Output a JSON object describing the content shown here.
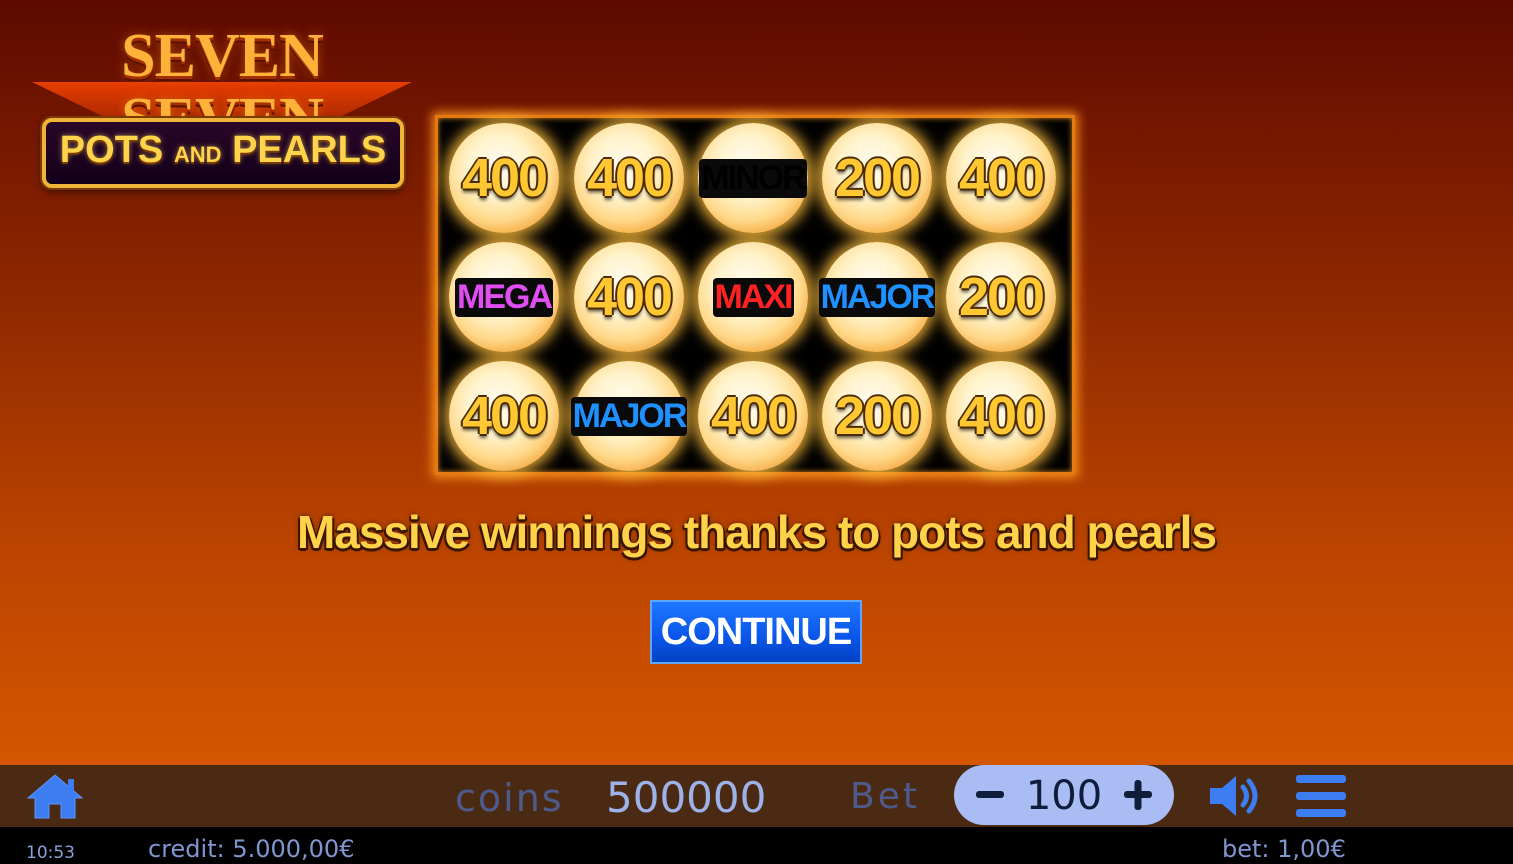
{
  "logo": {
    "title": "SEVEN SEVEN",
    "subtitle_pots": "POTS",
    "subtitle_and": "AND",
    "subtitle_pearls": "PEARLS"
  },
  "grid": {
    "rows": [
      [
        {
          "text": "400",
          "kind": "number"
        },
        {
          "text": "400",
          "kind": "number"
        },
        {
          "text": "MINOR",
          "kind": "minor"
        },
        {
          "text": "200",
          "kind": "number"
        },
        {
          "text": "400",
          "kind": "number"
        }
      ],
      [
        {
          "text": "MEGA",
          "kind": "mega"
        },
        {
          "text": "400",
          "kind": "number"
        },
        {
          "text": "MAXI",
          "kind": "maxi"
        },
        {
          "text": "MAJOR",
          "kind": "major"
        },
        {
          "text": "200",
          "kind": "number"
        }
      ],
      [
        {
          "text": "400",
          "kind": "number"
        },
        {
          "text": "MAJOR",
          "kind": "major"
        },
        {
          "text": "400",
          "kind": "number"
        },
        {
          "text": "200",
          "kind": "number"
        },
        {
          "text": "400",
          "kind": "number"
        }
      ]
    ],
    "pearl_flags": [
      [
        true,
        true,
        true,
        false,
        true
      ],
      [
        false,
        true,
        false,
        false,
        true
      ],
      [
        true,
        true,
        true,
        true,
        true
      ]
    ]
  },
  "message": "Massive winnings thanks to pots and pearls",
  "continue_label": "CONTINUE",
  "controls": {
    "coins_label": "coins",
    "coins_value": "500000",
    "bet_label": "Bet",
    "bet_value": "100"
  },
  "status": {
    "clock": "10:53",
    "credit": "credit: 5.000,00€",
    "bet": "bet: 1,00€"
  },
  "colors": {
    "background_top": "#5e0a00",
    "background_bottom": "#d55600",
    "button_blue": "#0a55e8",
    "number_gold": "#ffc832",
    "minor_green": "#3be31a",
    "mega_purple": "#e04ef2",
    "maxi_red": "#ff2222",
    "major_blue": "#1f90ff"
  },
  "icons": {
    "home": "home-icon",
    "minus": "minus-icon",
    "plus": "plus-icon",
    "sound": "speaker-icon",
    "menu": "hamburger-menu-icon"
  }
}
